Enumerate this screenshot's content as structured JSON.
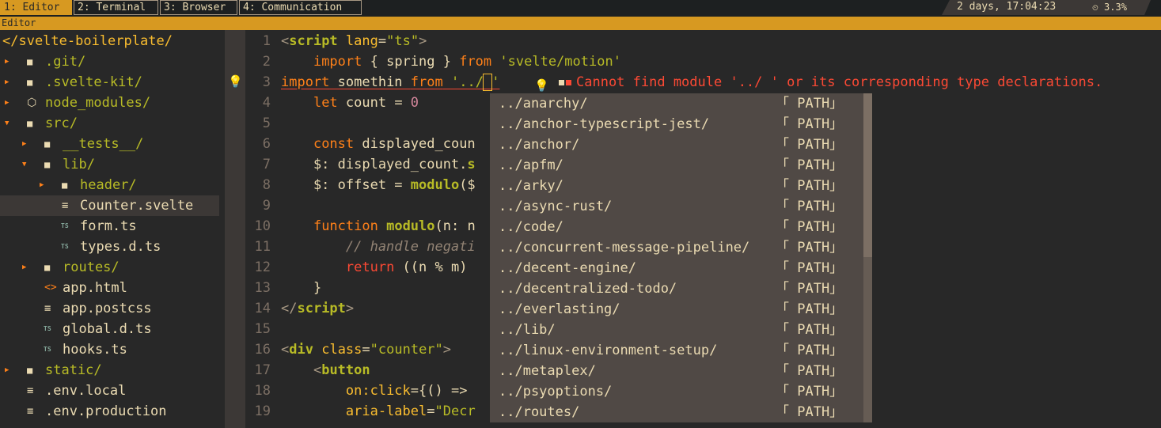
{
  "topbar": {
    "workspaces": [
      {
        "label": "1: Editor",
        "active": true
      },
      {
        "label": "2: Terminal",
        "active": false
      },
      {
        "label": "3: Browser",
        "active": false
      },
      {
        "label": "4: Communication",
        "active": false
      }
    ],
    "uptime": "2 days, 17:04:23",
    "cpu": "3.3%"
  },
  "window_title": "Editor",
  "tree": {
    "root": "</svelte-boilerplate/",
    "items": [
      {
        "label": ".git/",
        "kind": "dir",
        "depth": 0,
        "expanded": false
      },
      {
        "label": ".svelte-kit/",
        "kind": "dir",
        "depth": 0,
        "expanded": false
      },
      {
        "label": "node_modules/",
        "kind": "dir-node",
        "depth": 0,
        "expanded": false
      },
      {
        "label": "src/",
        "kind": "dir",
        "depth": 0,
        "expanded": true
      },
      {
        "label": "__tests__/",
        "kind": "dir",
        "depth": 1,
        "expanded": false
      },
      {
        "label": "lib/",
        "kind": "dir",
        "depth": 1,
        "expanded": true
      },
      {
        "label": "header/",
        "kind": "dir",
        "depth": 2,
        "expanded": false
      },
      {
        "label": "Counter.svelte",
        "kind": "file",
        "depth": 2,
        "selected": true
      },
      {
        "label": "form.ts",
        "kind": "ts",
        "depth": 2
      },
      {
        "label": "types.d.ts",
        "kind": "ts",
        "depth": 2
      },
      {
        "label": "routes/",
        "kind": "dir",
        "depth": 1,
        "expanded": false
      },
      {
        "label": "app.html",
        "kind": "html",
        "depth": 1
      },
      {
        "label": "app.postcss",
        "kind": "file",
        "depth": 1
      },
      {
        "label": "global.d.ts",
        "kind": "ts",
        "depth": 1
      },
      {
        "label": "hooks.ts",
        "kind": "ts",
        "depth": 1
      },
      {
        "label": "static/",
        "kind": "dir",
        "depth": 0,
        "expanded": false
      },
      {
        "label": ".env.local",
        "kind": "file",
        "depth": 0
      },
      {
        "label": ".env.production",
        "kind": "file",
        "depth": 0
      }
    ]
  },
  "editor": {
    "lines": [
      {
        "n": "1",
        "tokens": [
          [
            "punc",
            "<"
          ],
          [
            "tag",
            "script"
          ],
          [
            "plain",
            " "
          ],
          [
            "attr",
            "lang"
          ],
          [
            "plain",
            "="
          ],
          [
            "str",
            "\"ts\""
          ],
          [
            "punc",
            ">"
          ]
        ]
      },
      {
        "n": "2",
        "tokens": [
          [
            "plain",
            "    "
          ],
          [
            "kw",
            "import"
          ],
          [
            "plain",
            " { spring } "
          ],
          [
            "kw",
            "from"
          ],
          [
            "plain",
            " "
          ],
          [
            "str",
            "'svelte/motion'"
          ]
        ]
      },
      {
        "n": "3",
        "tokens": [
          [
            "kw err-ul",
            "import"
          ],
          [
            "plain err-ul",
            " somethin "
          ],
          [
            "kw err-ul",
            "from"
          ],
          [
            "plain err-ul",
            " "
          ],
          [
            "str err-ul",
            "'../"
          ],
          [
            "str err-ul cursor",
            " "
          ],
          [
            "str err-ul",
            "'"
          ]
        ]
      },
      {
        "n": "4",
        "tokens": [
          [
            "plain",
            "    "
          ],
          [
            "kw",
            "let"
          ],
          [
            "plain",
            " count = "
          ],
          [
            "num",
            "0"
          ]
        ]
      },
      {
        "n": "5",
        "tokens": []
      },
      {
        "n": "6",
        "tokens": [
          [
            "plain",
            "    "
          ],
          [
            "kw",
            "const"
          ],
          [
            "plain",
            " displayed_coun"
          ]
        ]
      },
      {
        "n": "7",
        "tokens": [
          [
            "plain",
            "    $: displayed_count."
          ],
          [
            "fn",
            "s"
          ]
        ]
      },
      {
        "n": "8",
        "tokens": [
          [
            "plain",
            "    $: offset = "
          ],
          [
            "fn",
            "modulo"
          ],
          [
            "plain",
            "($"
          ]
        ]
      },
      {
        "n": "9",
        "tokens": []
      },
      {
        "n": "10",
        "tokens": [
          [
            "plain",
            "    "
          ],
          [
            "kw",
            "function"
          ],
          [
            "plain",
            " "
          ],
          [
            "fn",
            "modulo"
          ],
          [
            "plain",
            "(n: n"
          ]
        ]
      },
      {
        "n": "11",
        "tokens": [
          [
            "cm",
            "        // handle negati"
          ]
        ]
      },
      {
        "n": "12",
        "tokens": [
          [
            "plain",
            "        "
          ],
          [
            "kw2",
            "return"
          ],
          [
            "plain",
            " ((n % m)"
          ]
        ]
      },
      {
        "n": "13",
        "tokens": [
          [
            "plain",
            "    }"
          ]
        ]
      },
      {
        "n": "14",
        "tokens": [
          [
            "punc",
            "</"
          ],
          [
            "tag",
            "script"
          ],
          [
            "punc",
            ">"
          ]
        ]
      },
      {
        "n": "15",
        "tokens": []
      },
      {
        "n": "16",
        "tokens": [
          [
            "punc",
            "<"
          ],
          [
            "tag",
            "div"
          ],
          [
            "plain",
            " "
          ],
          [
            "attr",
            "class"
          ],
          [
            "plain",
            "="
          ],
          [
            "str",
            "\"counter\""
          ],
          [
            "punc",
            ">"
          ]
        ]
      },
      {
        "n": "17",
        "tokens": [
          [
            "plain",
            "    "
          ],
          [
            "punc",
            "<"
          ],
          [
            "tag",
            "button"
          ]
        ]
      },
      {
        "n": "18",
        "tokens": [
          [
            "plain",
            "        "
          ],
          [
            "attr",
            "on:click"
          ],
          [
            "plain",
            "={() => "
          ]
        ]
      },
      {
        "n": "19",
        "tokens": [
          [
            "plain",
            "        "
          ],
          [
            "attr",
            "aria-label"
          ],
          [
            "plain",
            "="
          ],
          [
            "str",
            "\"Decr"
          ]
        ]
      }
    ],
    "diagnostic": "Cannot find module '../ ' or its corresponding type declarations."
  },
  "completion": {
    "items": [
      {
        "label": "../anarchy/",
        "kind": "「 PATH」"
      },
      {
        "label": "../anchor-typescript-jest/",
        "kind": "「 PATH」"
      },
      {
        "label": "../anchor/",
        "kind": "「 PATH」"
      },
      {
        "label": "../apfm/",
        "kind": "「 PATH」"
      },
      {
        "label": "../arky/",
        "kind": "「 PATH」"
      },
      {
        "label": "../async-rust/",
        "kind": "「 PATH」"
      },
      {
        "label": "../code/",
        "kind": "「 PATH」"
      },
      {
        "label": "../concurrent-message-pipeline/",
        "kind": "「 PATH」"
      },
      {
        "label": "../decent-engine/",
        "kind": "「 PATH」"
      },
      {
        "label": "../decentralized-todo/",
        "kind": "「 PATH」"
      },
      {
        "label": "../everlasting/",
        "kind": "「 PATH」"
      },
      {
        "label": "../lib/",
        "kind": "「 PATH」"
      },
      {
        "label": "../linux-environment-setup/",
        "kind": "「 PATH」"
      },
      {
        "label": "../metaplex/",
        "kind": "「 PATH」"
      },
      {
        "label": "../psyoptions/",
        "kind": "「 PATH」"
      },
      {
        "label": "../routes/",
        "kind": "「 PATH」"
      }
    ]
  },
  "colors": {
    "accent": "#d79921",
    "background": "#282828",
    "error": "#fb4934",
    "directory": "#b8bb26"
  }
}
